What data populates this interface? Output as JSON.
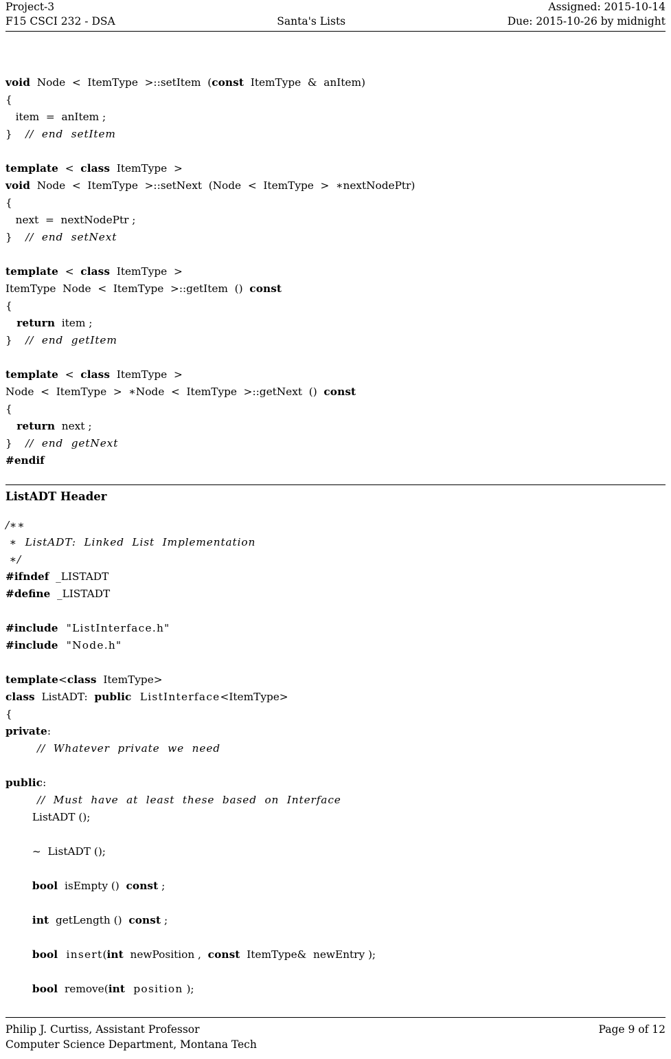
{
  "header": {
    "left_top": "Project-3",
    "left_bottom": "F15 CSCI 232 - DSA",
    "center": "Santa's Lists",
    "right_top": "Assigned: 2015-10-14",
    "right_bottom": "Due: 2015-10-26 by midnight"
  },
  "footer": {
    "left_top": "Philip J. Curtiss, Assistant Professor",
    "left_bottom": "Computer Science Department, Montana Tech",
    "right": "Page 9 of 12"
  },
  "section": {
    "listadt_header_title": "ListADT Header"
  },
  "listing_node": {
    "lines": [
      [
        {
          "t": "kw",
          "v": "void"
        },
        {
          "t": "id",
          "v": "  Node  <  ItemType  >::setItem  ("
        },
        {
          "t": "kw",
          "v": "const"
        },
        {
          "t": "id",
          "v": "  ItemType  &  anItem)"
        }
      ],
      [
        {
          "t": "id",
          "v": "{"
        }
      ],
      [
        {
          "t": "id",
          "v": "   item  =  anItem ;"
        }
      ],
      [
        {
          "t": "id",
          "v": "}    "
        },
        {
          "t": "cm",
          "v": "//  end  setItem"
        }
      ],
      [
        {
          "t": "id",
          "v": ""
        }
      ],
      [
        {
          "t": "kw",
          "v": "template"
        },
        {
          "t": "id",
          "v": "  <  "
        },
        {
          "t": "kw",
          "v": "class"
        },
        {
          "t": "id",
          "v": "  ItemType  >"
        }
      ],
      [
        {
          "t": "kw",
          "v": "void"
        },
        {
          "t": "id",
          "v": "  Node  <  ItemType  >::setNext  (Node  <  ItemType  >  ∗nextNodePtr)"
        }
      ],
      [
        {
          "t": "id",
          "v": "{"
        }
      ],
      [
        {
          "t": "id",
          "v": "   next  =  nextNodePtr ;"
        }
      ],
      [
        {
          "t": "id",
          "v": "}    "
        },
        {
          "t": "cm",
          "v": "//  end  setNext"
        }
      ],
      [
        {
          "t": "id",
          "v": ""
        }
      ],
      [
        {
          "t": "kw",
          "v": "template"
        },
        {
          "t": "id",
          "v": "  <  "
        },
        {
          "t": "kw",
          "v": "class"
        },
        {
          "t": "id",
          "v": "  ItemType  >"
        }
      ],
      [
        {
          "t": "id",
          "v": "ItemType  Node  <  ItemType  >::getItem  ()  "
        },
        {
          "t": "kw",
          "v": "const"
        }
      ],
      [
        {
          "t": "id",
          "v": "{"
        }
      ],
      [
        {
          "t": "kw",
          "v": "   return"
        },
        {
          "t": "id",
          "v": "  item ;"
        }
      ],
      [
        {
          "t": "id",
          "v": "}    "
        },
        {
          "t": "cm",
          "v": "//  end  getItem"
        }
      ],
      [
        {
          "t": "id",
          "v": ""
        }
      ],
      [
        {
          "t": "kw",
          "v": "template"
        },
        {
          "t": "id",
          "v": "  <  "
        },
        {
          "t": "kw",
          "v": "class"
        },
        {
          "t": "id",
          "v": "  ItemType  >"
        }
      ],
      [
        {
          "t": "id",
          "v": "Node  <  ItemType  >  ∗Node  <  ItemType  >::getNext  ()  "
        },
        {
          "t": "kw",
          "v": "const"
        }
      ],
      [
        {
          "t": "id",
          "v": "{"
        }
      ],
      [
        {
          "t": "kw",
          "v": "   return"
        },
        {
          "t": "id",
          "v": "  next ;"
        }
      ],
      [
        {
          "t": "id",
          "v": "}    "
        },
        {
          "t": "cm",
          "v": "//  end  getNext"
        }
      ],
      [
        {
          "t": "pp",
          "v": "#endif"
        }
      ]
    ]
  },
  "listing_listadt": {
    "lines": [
      [
        {
          "t": "cm",
          "v": "/∗∗"
        }
      ],
      [
        {
          "t": "cm",
          "v": " ∗  ListADT:  Linked  List  Implementation"
        }
      ],
      [
        {
          "t": "cm",
          "v": " ∗/"
        }
      ],
      [
        {
          "t": "pp",
          "v": "#ifndef"
        },
        {
          "t": "id",
          "v": "  _LISTADT"
        }
      ],
      [
        {
          "t": "pp",
          "v": "#define"
        },
        {
          "t": "id",
          "v": "  _LISTADT"
        }
      ],
      [
        {
          "t": "id",
          "v": ""
        }
      ],
      [
        {
          "t": "pp",
          "v": "#include"
        },
        {
          "t": "st",
          "v": "  \"ListInterface.h\""
        }
      ],
      [
        {
          "t": "pp",
          "v": "#include"
        },
        {
          "t": "st",
          "v": "  \"Node.h\""
        }
      ],
      [
        {
          "t": "id",
          "v": ""
        }
      ],
      [
        {
          "t": "kw",
          "v": "template"
        },
        {
          "t": "id",
          "v": "<"
        },
        {
          "t": "kw",
          "v": "class"
        },
        {
          "t": "id",
          "v": "  ItemType>"
        }
      ],
      [
        {
          "t": "kw",
          "v": "class"
        },
        {
          "t": "id",
          "v": "  ListADT:  "
        },
        {
          "t": "kw",
          "v": "public"
        },
        {
          "t": "st",
          "v": "  ListInterface"
        },
        {
          "t": "id",
          "v": "<ItemType>"
        }
      ],
      [
        {
          "t": "id",
          "v": "{"
        }
      ],
      [
        {
          "t": "kw",
          "v": "private"
        },
        {
          "t": "id",
          "v": ":"
        }
      ],
      [
        {
          "t": "cm",
          "v": "        //  Whatever  private  we  need"
        }
      ],
      [
        {
          "t": "id",
          "v": ""
        }
      ],
      [
        {
          "t": "kw",
          "v": "public"
        },
        {
          "t": "id",
          "v": ":"
        }
      ],
      [
        {
          "t": "cm",
          "v": "        //  Must  have  at  least  these  based  on  Interface"
        }
      ],
      [
        {
          "t": "id",
          "v": "        ListADT ();"
        }
      ],
      [
        {
          "t": "id",
          "v": ""
        }
      ],
      [
        {
          "t": "id",
          "v": "        ~  ListADT ();"
        }
      ],
      [
        {
          "t": "id",
          "v": ""
        }
      ],
      [
        {
          "t": "id",
          "v": "        "
        },
        {
          "t": "kw",
          "v": "bool"
        },
        {
          "t": "id",
          "v": "  isEmpty ()  "
        },
        {
          "t": "kw",
          "v": "const"
        },
        {
          "t": "id",
          "v": " ;"
        }
      ],
      [
        {
          "t": "id",
          "v": ""
        }
      ],
      [
        {
          "t": "id",
          "v": "        "
        },
        {
          "t": "kw",
          "v": "int"
        },
        {
          "t": "id",
          "v": "  getLength ()  "
        },
        {
          "t": "kw",
          "v": "const"
        },
        {
          "t": "id",
          "v": " ;"
        }
      ],
      [
        {
          "t": "id",
          "v": ""
        }
      ],
      [
        {
          "t": "id",
          "v": "        "
        },
        {
          "t": "kw",
          "v": "bool"
        },
        {
          "t": "st",
          "v": "  insert"
        },
        {
          "t": "id",
          "v": "("
        },
        {
          "t": "kw",
          "v": "int"
        },
        {
          "t": "id",
          "v": "  newPosition ,  "
        },
        {
          "t": "kw",
          "v": "const"
        },
        {
          "t": "id",
          "v": "  ItemType&  newEntry );"
        }
      ],
      [
        {
          "t": "id",
          "v": ""
        }
      ],
      [
        {
          "t": "id",
          "v": "        "
        },
        {
          "t": "kw",
          "v": "bool"
        },
        {
          "t": "id",
          "v": "  remove("
        },
        {
          "t": "kw",
          "v": "int"
        },
        {
          "t": "st",
          "v": "  position"
        },
        {
          "t": "id",
          "v": " );"
        }
      ]
    ]
  }
}
